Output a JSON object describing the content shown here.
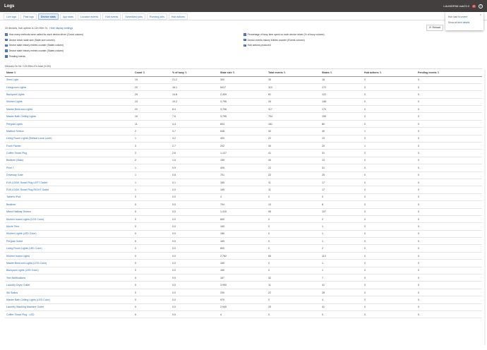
{
  "header": {
    "title": "Logs",
    "user": "LAUNDRIM-hub23.0",
    "notification_count": "2"
  },
  "tabs": [
    {
      "label": "Live logs",
      "active": false
    },
    {
      "label": "Past logs",
      "active": false
    },
    {
      "label": "Device stats",
      "active": true
    },
    {
      "label": "App stats",
      "active": false
    },
    {
      "label": "Location events",
      "active": false
    },
    {
      "label": "Hub events",
      "active": false
    },
    {
      "label": "Scheduled jobs",
      "active": false
    },
    {
      "label": "Running jobs",
      "active": false
    },
    {
      "label": "Hub actions",
      "active": false
    }
  ],
  "summary": {
    "text": "33 devices, hub uptime is 12h 59m 7s",
    "link": "Hide display settings"
  },
  "reload_label": "Reload",
  "popup": {
    "line1_prefix": "Hub load is",
    "line1_link": "severe",
    "line2_prefix": "Show all",
    "line2_link": "alert details",
    "close": "×"
  },
  "options_left": [
    "How many methods were called for each device driver (Count column)",
    "Device driver state size (State size column)",
    "Device state history entries counter (States column)",
    "Device state history entries counter (States column)",
    "Pending events"
  ],
  "options_right": [
    "Percentage of busy time spent on each device driver (% of busy column)",
    "Device events history entries counter (Events column)",
    "Hub actions produced"
  ],
  "since": "Devices On 0d / 12h 59m 47s total (3.0%)",
  "columns": [
    "Name",
    "Count",
    "% of busy",
    "State size",
    "Total events",
    "States",
    "Hub actions",
    "Pending events"
  ],
  "rows": [
    [
      "Shed Light",
      "19",
      "21.2",
      "300",
      "30",
      "18",
      "0",
      "0"
    ],
    [
      "Livingroom Lights",
      "20",
      "16.1",
      "5417",
      "110",
      "172",
      "0",
      "0"
    ],
    [
      "Backyard Lights",
      "29",
      "14.8",
      "2,409",
      "81",
      "122",
      "0",
      "0"
    ],
    [
      "Kitchen Lights",
      "24",
      "10.2",
      "3,796",
      "34",
      "148",
      "0",
      "0"
    ],
    [
      "Master Bedroom Lights",
      "22",
      "8.4",
      "3,796",
      "117",
      "170",
      "0",
      "0"
    ],
    [
      "Master Bath Ceiling Lights",
      "10",
      "7.6",
      "3,795",
      "704",
      "199",
      "0",
      "0"
    ],
    [
      "Pergola Lights",
      "11",
      "4.4",
      "804",
      "181",
      "80",
      "0",
      "0"
    ],
    [
      "Mailbox Sensor",
      "2",
      "3.7",
      "648",
      "32",
      "40",
      "1",
      "0"
    ],
    [
      "Living Room Lights (Default Local Level)",
      "1",
      "3.2",
      "400",
      "22",
      "13",
      "0",
      "0"
    ],
    [
      "Front Planter",
      "3",
      "2.7",
      "202",
      "30",
      "20",
      "1",
      "0"
    ],
    [
      "Coffee Smart Plug",
      "3",
      "2.6",
      "1,127",
      "41",
      "31",
      "0",
      "0"
    ],
    [
      "Bedtime (Main)",
      "2",
      "1.5",
      "159",
      "40",
      "13",
      "0",
      "0"
    ],
    [
      "Pixel 7",
      "1",
      "0.9",
      "405",
      "22",
      "31",
      "0",
      "0"
    ],
    [
      "Driveway Gate",
      "1",
      "0.8",
      "701",
      "22",
      "25",
      "0",
      "0"
    ],
    [
      "EVA LOGIK Smart Plug LEFT Outlet",
      "1",
      "0.1",
      "165",
      "11",
      "17",
      "0",
      "0"
    ],
    [
      "EVA LOGIK Smart Plug RIGHT Outlet",
      "1",
      "0.0",
      "165",
      "11",
      "17",
      "0",
      "0"
    ],
    [
      "Tablet's iPod",
      "0",
      "0.0",
      "4",
      "0",
      "0",
      "0",
      "0"
    ],
    [
      "Bedtime",
      "0",
      "0.0",
      "704",
      "10",
      "8",
      "0",
      "0"
    ],
    [
      "Mbed Hallway Sensor",
      "0",
      "0.0",
      "1,410",
      "95",
      "107",
      "0",
      "0"
    ],
    [
      "Kitchen Island Lights (LED Color)",
      "0",
      "0.0",
      "800",
      "0",
      "2",
      "0",
      "0"
    ],
    [
      "Movie Time",
      "0",
      "0.0",
      "160",
      "0",
      "1",
      "0",
      "0"
    ],
    [
      "Kitchen Lights (LED Color)",
      "0",
      "0.0",
      "180",
      "0",
      "1",
      "0",
      "0"
    ],
    [
      "Pergola Outlet",
      "0",
      "0.0",
      "165",
      "0",
      "1",
      "0",
      "0"
    ],
    [
      "Living Room Lights (LED Color)",
      "0",
      "0.0",
      "800",
      "0",
      "2",
      "0",
      "0"
    ],
    [
      "Kitchen Island Lights",
      "0",
      "0.0",
      "2,782",
      "85",
      "110",
      "0",
      "0"
    ],
    [
      "Master Bedroom Lights (LED Color)",
      "0",
      "0.0",
      "160",
      "0",
      "1",
      "0",
      "0"
    ],
    [
      "Backyard Lights (LED Color)",
      "0",
      "0.0",
      "160",
      "0",
      "1",
      "0",
      "0"
    ],
    [
      "Text Notifications",
      "0",
      "0.0",
      "167",
      "32",
      "7",
      "0",
      "0"
    ],
    [
      "Laundry Dryer Outlet",
      "0",
      "0.0",
      "3,990",
      "11",
      "41",
      "0",
      "0"
    ],
    [
      "Ski Status",
      "0",
      "0.0",
      "200",
      "22",
      "28",
      "0",
      "0"
    ],
    [
      "Master Bath Ceiling Lights (LED Color)",
      "0",
      "0.0",
      "970",
      "0",
      "4",
      "0",
      "0"
    ],
    [
      "Laundry Washing Machine Outlet",
      "0",
      "0.0",
      "2,949",
      "20",
      "41",
      "0",
      "0"
    ],
    [
      "Coffee Smart Plug - LED",
      "0",
      "0.0",
      "4",
      "0",
      "0",
      "0",
      "0"
    ]
  ]
}
